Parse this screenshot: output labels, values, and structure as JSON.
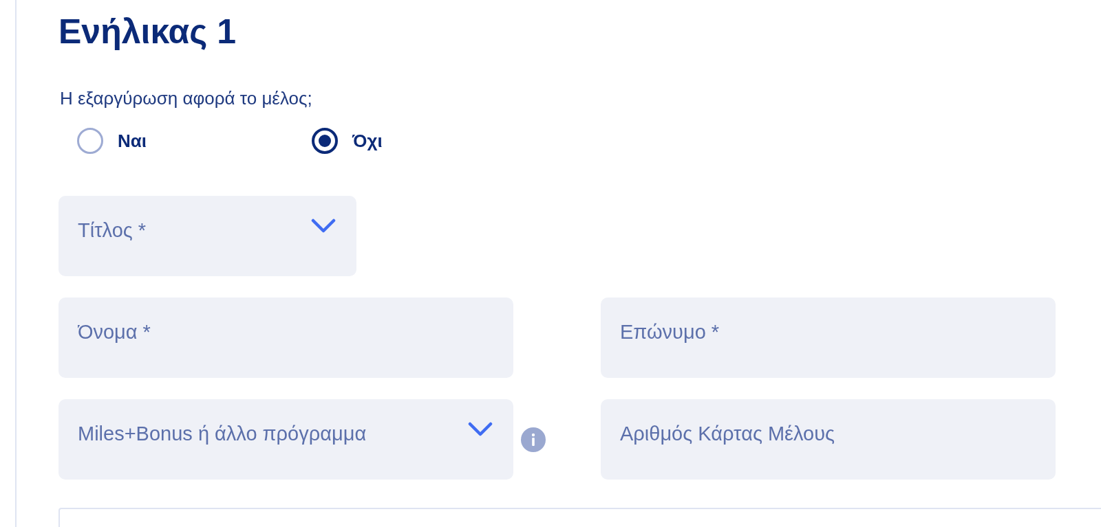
{
  "heading": "Ενήλικας 1",
  "question": {
    "text": "Η εξαργύρωση αφορά το μέλος;",
    "options": [
      {
        "label": "Ναι",
        "selected": false
      },
      {
        "label": "Όχι",
        "selected": true
      }
    ]
  },
  "form_rows": [
    {
      "fields": [
        {
          "kind": "select",
          "placeholder": "Τίτλος *"
        }
      ]
    },
    {
      "fields": [
        {
          "kind": "text",
          "placeholder": "Όνομα *"
        },
        {
          "kind": "text",
          "placeholder": "Επώνυμο *"
        }
      ]
    },
    {
      "fields": [
        {
          "kind": "select",
          "placeholder": "Miles+Bonus ή άλλο πρόγραμμα",
          "info": true
        },
        {
          "kind": "text",
          "placeholder": "Αριθμός Κάρτας Μέλους"
        }
      ]
    }
  ]
}
